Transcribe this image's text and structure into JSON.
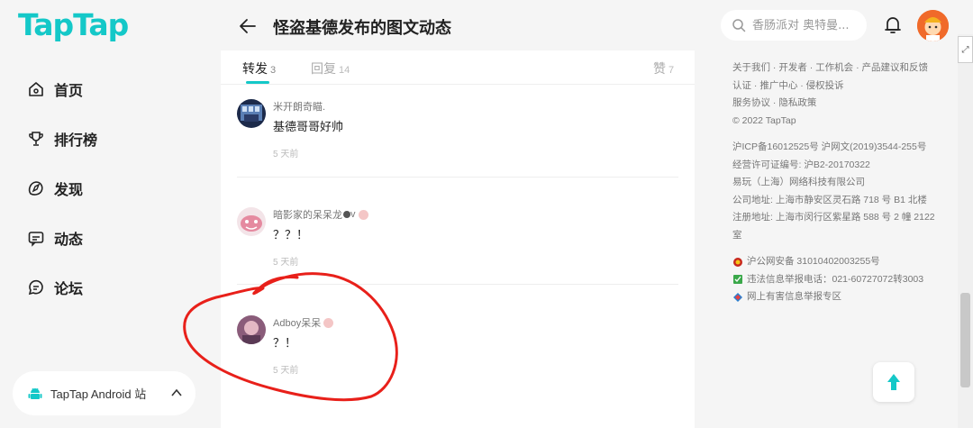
{
  "app": {
    "logo": "TapTap",
    "brand_color": "#14c8c8"
  },
  "sidebar": {
    "items": [
      {
        "label": "首页",
        "icon": "home-icon"
      },
      {
        "label": "排行榜",
        "icon": "trophy-icon"
      },
      {
        "label": "发现",
        "icon": "compass-icon"
      },
      {
        "label": "动态",
        "icon": "message-icon"
      },
      {
        "label": "论坛",
        "icon": "forum-icon"
      }
    ],
    "android": {
      "label": "TapTap Android 站",
      "icon": "android-icon"
    }
  },
  "header": {
    "title": "怪盗基德发布的图文动态",
    "back_icon": "arrow-left-icon"
  },
  "search": {
    "placeholder": "香肠派对 奥特曼..."
  },
  "tabs": [
    {
      "label": "转发",
      "count": "3",
      "active": true
    },
    {
      "label": "回复",
      "count": "14",
      "active": false
    },
    {
      "label": "赞",
      "count": "7",
      "active": false
    }
  ],
  "comments": [
    {
      "user": "米开朗奇瞄.",
      "text": "基德哥哥好帅",
      "time": "5 天前"
    },
    {
      "user": "暗影家的呆呆龙",
      "user_suffix": "v",
      "text": "？？！",
      "time": "5 天前"
    },
    {
      "user": "Adboy呆呆",
      "text": "？！",
      "time": "5 天前"
    }
  ],
  "footer": {
    "links": "关于我们 · 开发者 · 工作机会 · 产品建议和反馈",
    "links2": "认证 · 推广中心 · 侵权投诉",
    "links3": "服务协议 · 隐私政策",
    "copyright": "© 2022 TapTap",
    "icp": "沪ICP备16012525号   沪网文(2019)3544-255号",
    "license": "经营许可证编号: 沪B2-20170322",
    "company": "易玩（上海）网络科技有限公司",
    "address": "公司地址: 上海市静安区灵石路 718 号 B1 北楼",
    "reg_address": "注册地址: 上海市闵行区紫星路 588 号 2 幢 2122 室",
    "police": "沪公网安备 31010402003255号",
    "report": "违法信息举报电话：021-60727072转3003",
    "harmful": "网上有害信息举报专区"
  },
  "colors": {
    "annotation_stroke": "#e8201a"
  }
}
